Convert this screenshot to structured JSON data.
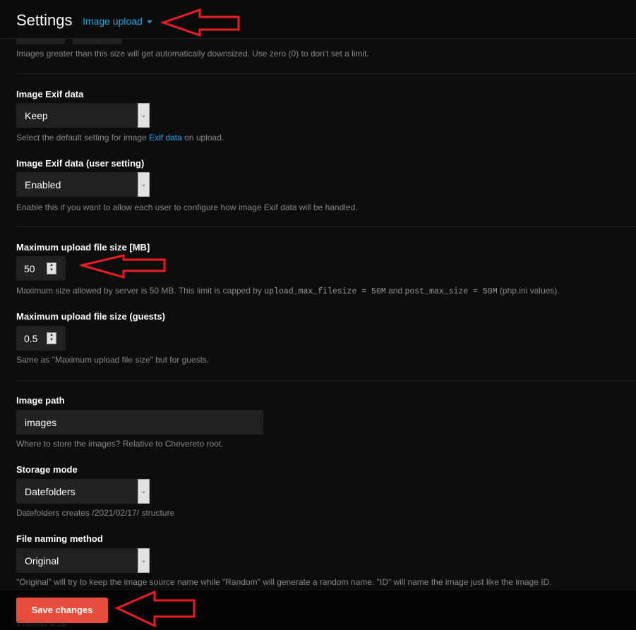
{
  "header": {
    "title": "Settings",
    "section": "Image upload"
  },
  "top_help": "Images greater than this size will get automatically downsized. Use zero (0) to don't set a limit.",
  "exif": {
    "label": "Image Exif data",
    "value": "Keep",
    "help_pre": "Select the default setting for image ",
    "help_link": "Exif data",
    "help_post": " on upload."
  },
  "exif_user": {
    "label": "Image Exif data (user setting)",
    "value": "Enabled",
    "help": "Enable this if you want to allow each user to configure how image Exif data will be handled."
  },
  "max_size": {
    "label": "Maximum upload file size [MB]",
    "value": "50",
    "help_pre": "Maximum size allowed by server is 50 MB. This limit is capped by ",
    "code1": "upload_max_filesize = 50M",
    "help_mid": " and ",
    "code2": "post_max_size = 50M",
    "help_post": " (php.ini values)."
  },
  "max_size_guests": {
    "label": "Maximum upload file size (guests)",
    "value": "0.5",
    "help": "Same as \"Maximum upload file size\" but for guests."
  },
  "image_path": {
    "label": "Image path",
    "value": "images",
    "help": "Where to store the images? Relative to Chevereto root."
  },
  "storage_mode": {
    "label": "Storage mode",
    "value": "Datefolders",
    "help": "Datefolders creates /2021/02/17/ structure"
  },
  "naming": {
    "label": "File naming method",
    "value": "Original",
    "help": "\"Original\" will try to keep the image source name while \"Random\" will generate a random name. \"ID\" will name the image just like the image ID."
  },
  "next_label": "Thumb size",
  "footer": {
    "save_label": "Save changes"
  },
  "colors": {
    "accent": "#22a7e0",
    "save": "#e84c3d",
    "annotation": "#ed1c24"
  }
}
